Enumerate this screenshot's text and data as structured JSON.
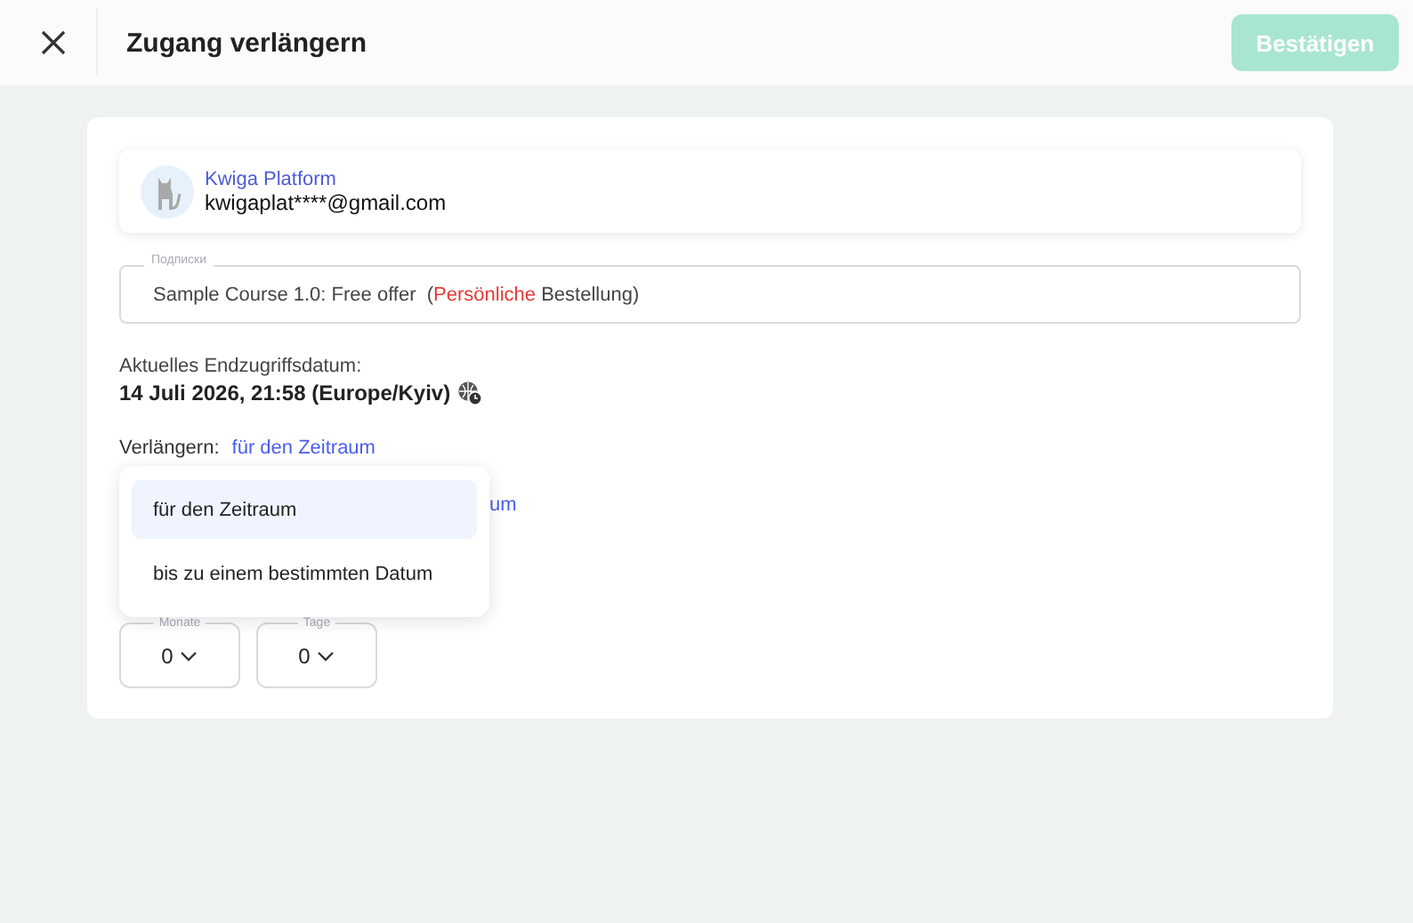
{
  "header": {
    "title": "Zugang verlängern",
    "confirm_button": {
      "label": "Bestätigen",
      "disabled": true
    }
  },
  "account": {
    "name": "Kwiga Platform",
    "email": "kwigaplat****@gmail.com"
  },
  "subscription": {
    "label": "Подписки",
    "course": "Sample Course 1.0: Free offer",
    "order_open": "(",
    "order_kind": "Persönliche",
    "order_rest": "Bestellung)"
  },
  "end_date": {
    "label": "Aktuelles Endzugriffsdatum:",
    "value": "14 Juli 2026, 21:58 (Europe/Kyiv)"
  },
  "extend": {
    "label": "Verlängern:",
    "value": "für den Zeitraum",
    "hidden_link": "um"
  },
  "menu": [
    {
      "label": "für den Zeitraum",
      "selected": true
    },
    {
      "label": "bis zu einem bestimmten Datum",
      "selected": false
    }
  ],
  "durations": [
    {
      "label": "Monate",
      "value": "0"
    },
    {
      "label": "Tage",
      "value": "0"
    }
  ]
}
